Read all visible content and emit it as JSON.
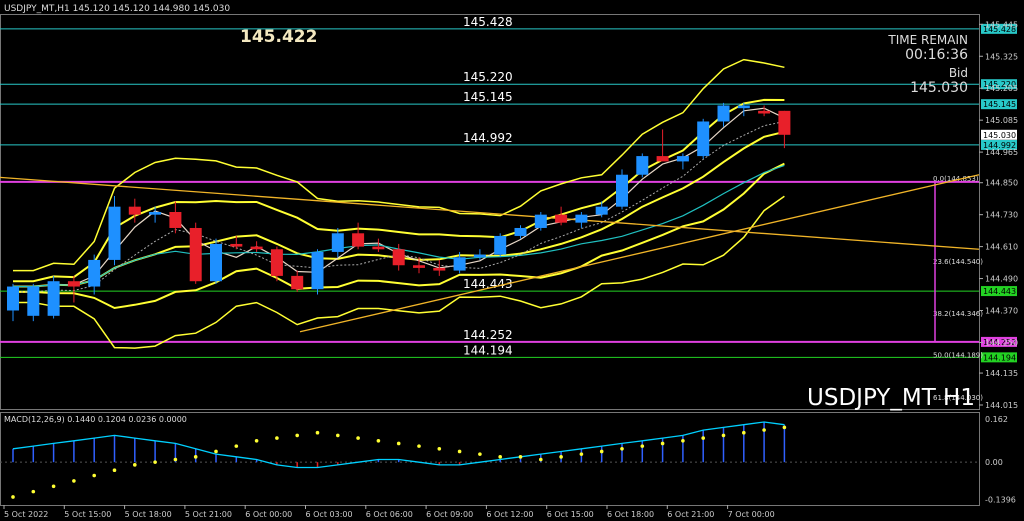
{
  "header": {
    "symbol_info": "USDJPY_MT,H1  145.120 145.120 144.980 145.030",
    "big_price": "145.422",
    "time_remain_label": "TIME REMAIN",
    "time_remain_value": "00:16:36",
    "bid_label": "Bid",
    "bid_value": "145.030",
    "watermark": "USDJPY_MT H1",
    "macd_label": "MACD(12,26,9) 0.1440 0.1204 0.0236 0.0000"
  },
  "colors": {
    "background": "#000000",
    "bull": "#1e90ff",
    "bear": "#e8202a",
    "level_line": "#28c8c8",
    "level_green": "#23d223",
    "bands": "#ffff33",
    "fibo": "#e040e0",
    "trend": "#f0b428",
    "macd_signal": "#ffff33",
    "macd_main": "#00d0ff"
  },
  "chart_data": {
    "type": "candlestick",
    "ylim": [
      144.0,
      145.48
    ],
    "y_ticks": [
      "145.445",
      "145.325",
      "145.205",
      "145.085",
      "144.965",
      "144.850",
      "144.730",
      "144.610",
      "144.490",
      "144.370",
      "144.250",
      "144.135",
      "144.015"
    ],
    "x_ticks": [
      "5 Oct 2022",
      "5 Oct 15:00",
      "5 Oct 18:00",
      "5 Oct 21:00",
      "6 Oct 00:00",
      "6 Oct 03:00",
      "6 Oct 06:00",
      "6 Oct 09:00",
      "6 Oct 12:00",
      "6 Oct 15:00",
      "6 Oct 18:00",
      "6 Oct 21:00",
      "7 Oct 00:00"
    ],
    "candles": [
      {
        "o": 144.37,
        "h": 144.47,
        "l": 144.33,
        "c": 144.46
      },
      {
        "o": 144.35,
        "h": 144.47,
        "l": 144.33,
        "c": 144.46
      },
      {
        "o": 144.35,
        "h": 144.5,
        "l": 144.34,
        "c": 144.48
      },
      {
        "o": 144.48,
        "h": 144.5,
        "l": 144.4,
        "c": 144.46
      },
      {
        "o": 144.46,
        "h": 144.58,
        "l": 144.43,
        "c": 144.56
      },
      {
        "o": 144.56,
        "h": 144.8,
        "l": 144.54,
        "c": 144.76
      },
      {
        "o": 144.76,
        "h": 144.79,
        "l": 144.7,
        "c": 144.73
      },
      {
        "o": 144.73,
        "h": 144.76,
        "l": 144.7,
        "c": 144.74
      },
      {
        "o": 144.74,
        "h": 144.78,
        "l": 144.66,
        "c": 144.68
      },
      {
        "o": 144.68,
        "h": 144.7,
        "l": 144.47,
        "c": 144.48
      },
      {
        "o": 144.48,
        "h": 144.64,
        "l": 144.47,
        "c": 144.62
      },
      {
        "o": 144.62,
        "h": 144.65,
        "l": 144.6,
        "c": 144.61
      },
      {
        "o": 144.61,
        "h": 144.63,
        "l": 144.59,
        "c": 144.6
      },
      {
        "o": 144.6,
        "h": 144.61,
        "l": 144.48,
        "c": 144.5
      },
      {
        "o": 144.5,
        "h": 144.52,
        "l": 144.44,
        "c": 144.45
      },
      {
        "o": 144.45,
        "h": 144.6,
        "l": 144.43,
        "c": 144.59
      },
      {
        "o": 144.59,
        "h": 144.68,
        "l": 144.57,
        "c": 144.66
      },
      {
        "o": 144.66,
        "h": 144.7,
        "l": 144.6,
        "c": 144.61
      },
      {
        "o": 144.61,
        "h": 144.64,
        "l": 144.59,
        "c": 144.6
      },
      {
        "o": 144.6,
        "h": 144.62,
        "l": 144.52,
        "c": 144.54
      },
      {
        "o": 144.54,
        "h": 144.57,
        "l": 144.51,
        "c": 144.53
      },
      {
        "o": 144.53,
        "h": 144.56,
        "l": 144.5,
        "c": 144.52
      },
      {
        "o": 144.52,
        "h": 144.59,
        "l": 144.51,
        "c": 144.57
      },
      {
        "o": 144.57,
        "h": 144.6,
        "l": 144.56,
        "c": 144.58
      },
      {
        "o": 144.58,
        "h": 144.66,
        "l": 144.57,
        "c": 144.65
      },
      {
        "o": 144.65,
        "h": 144.69,
        "l": 144.64,
        "c": 144.68
      },
      {
        "o": 144.68,
        "h": 144.74,
        "l": 144.67,
        "c": 144.73
      },
      {
        "o": 144.73,
        "h": 144.76,
        "l": 144.69,
        "c": 144.7
      },
      {
        "o": 144.7,
        "h": 144.74,
        "l": 144.68,
        "c": 144.73
      },
      {
        "o": 144.73,
        "h": 144.78,
        "l": 144.72,
        "c": 144.76
      },
      {
        "o": 144.76,
        "h": 144.9,
        "l": 144.75,
        "c": 144.88
      },
      {
        "o": 144.88,
        "h": 144.96,
        "l": 144.87,
        "c": 144.95
      },
      {
        "o": 144.95,
        "h": 145.05,
        "l": 144.94,
        "c": 144.93
      },
      {
        "o": 144.93,
        "h": 144.96,
        "l": 144.9,
        "c": 144.95
      },
      {
        "o": 144.95,
        "h": 145.09,
        "l": 144.94,
        "c": 145.08
      },
      {
        "o": 145.08,
        "h": 145.15,
        "l": 145.06,
        "c": 145.14
      },
      {
        "o": 145.13,
        "h": 145.15,
        "l": 145.1,
        "c": 145.14
      },
      {
        "o": 145.12,
        "h": 145.14,
        "l": 145.1,
        "c": 145.11
      },
      {
        "o": 145.12,
        "h": 145.12,
        "l": 144.98,
        "c": 145.03
      }
    ],
    "levels": [
      {
        "price": 145.428,
        "label": "145.428",
        "axis": "145.428",
        "kind": "level"
      },
      {
        "price": 145.22,
        "label": "145.220",
        "axis": "145.220",
        "kind": "level"
      },
      {
        "price": 145.145,
        "label": "145.145",
        "axis": "145.145",
        "kind": "level"
      },
      {
        "price": 144.992,
        "label": "144.992",
        "axis": "144.992",
        "kind": "level"
      },
      {
        "price": 144.443,
        "label": "144.443",
        "axis": "144.443",
        "kind": "level"
      },
      {
        "price": 144.252,
        "label": "144.252",
        "axis": "144.252",
        "kind": "level"
      },
      {
        "price": 144.194,
        "label": "144.194",
        "axis": "144.194",
        "kind": "level"
      }
    ],
    "current_price": {
      "price": 145.03,
      "axis": "145.030"
    },
    "fibo": [
      {
        "price": 144.853,
        "label": "0.0(144.853)"
      },
      {
        "price": 144.54,
        "label": "23.6(144.540)"
      },
      {
        "price": 144.346,
        "label": "38.2(144.346)"
      },
      {
        "price": 144.189,
        "label": "50.0(144.189)"
      },
      {
        "price": 144.03,
        "label": "61.8(144.030)"
      }
    ],
    "macd": {
      "y_ticks": [
        "0.162",
        "0.00",
        "-0.1396"
      ],
      "ylim": [
        -0.16,
        0.18
      ],
      "hist": [
        0.05,
        0.06,
        0.07,
        0.08,
        0.09,
        0.1,
        0.09,
        0.08,
        0.07,
        0.05,
        0.03,
        0.02,
        0.01,
        -0.01,
        -0.02,
        -0.02,
        -0.01,
        0.0,
        0.01,
        0.01,
        0.0,
        -0.01,
        -0.01,
        0.0,
        0.01,
        0.02,
        0.03,
        0.04,
        0.05,
        0.06,
        0.07,
        0.08,
        0.09,
        0.1,
        0.12,
        0.13,
        0.14,
        0.15,
        0.14
      ],
      "signal": [
        -0.13,
        -0.11,
        -0.09,
        -0.07,
        -0.05,
        -0.03,
        -0.01,
        0.0,
        0.01,
        0.02,
        0.04,
        0.06,
        0.08,
        0.09,
        0.1,
        0.11,
        0.1,
        0.09,
        0.08,
        0.07,
        0.06,
        0.05,
        0.04,
        0.03,
        0.02,
        0.02,
        0.01,
        0.02,
        0.03,
        0.04,
        0.05,
        0.06,
        0.07,
        0.08,
        0.09,
        0.1,
        0.11,
        0.12,
        0.13
      ]
    }
  }
}
